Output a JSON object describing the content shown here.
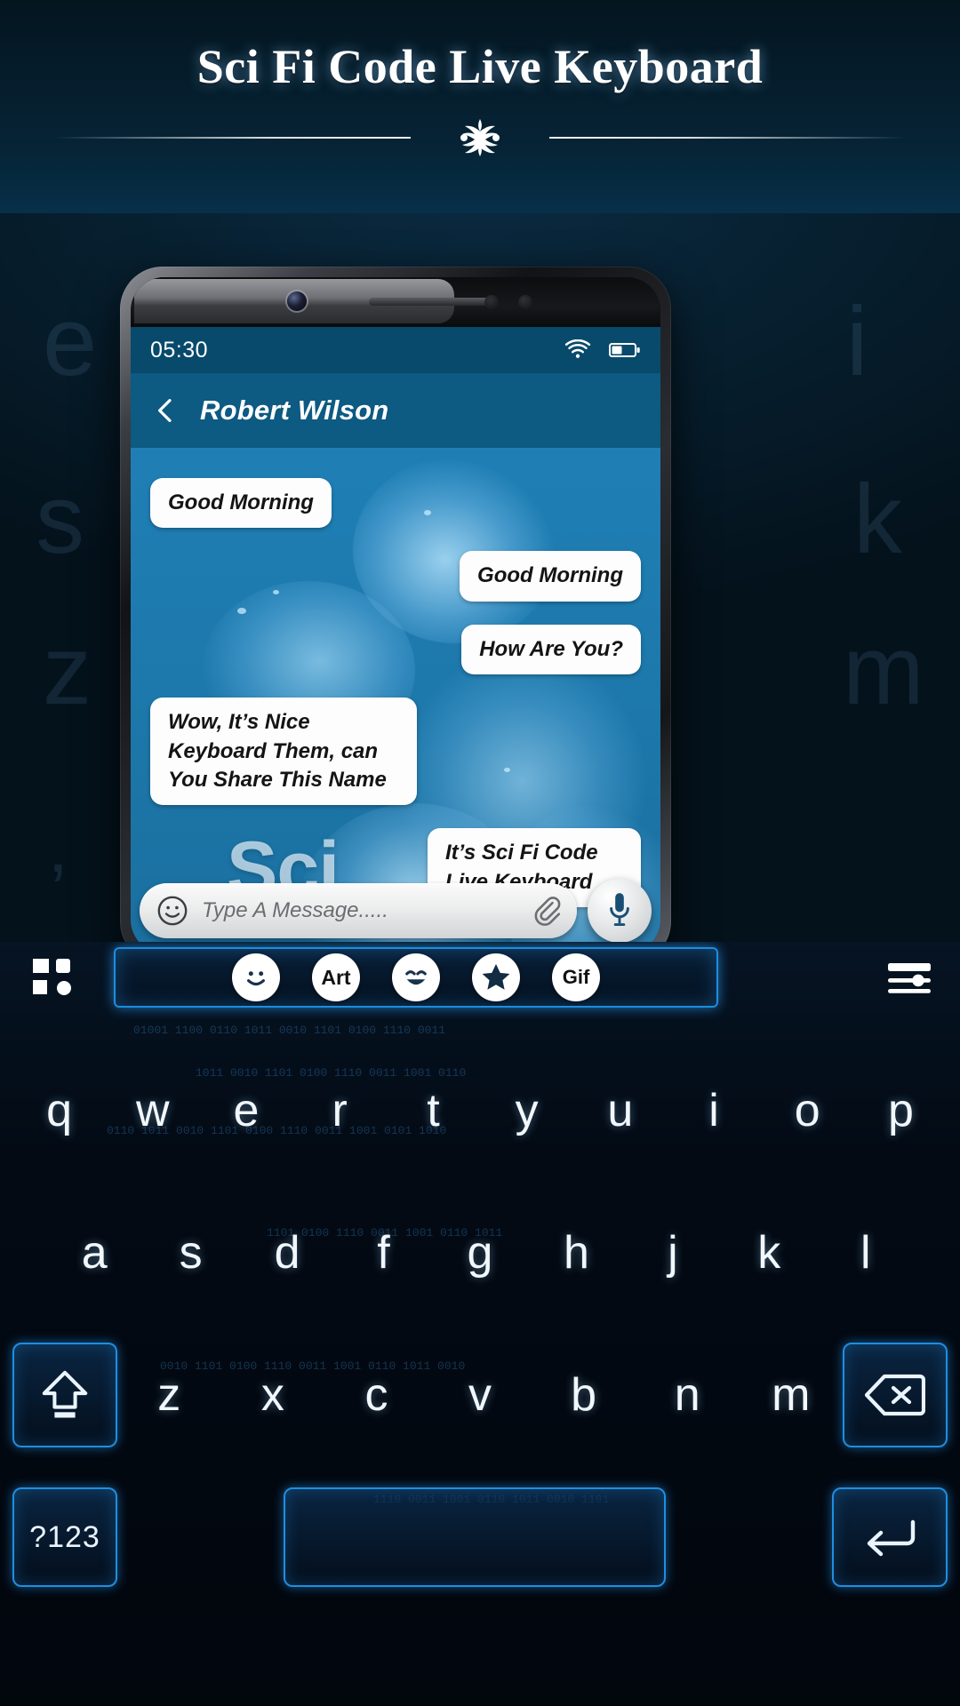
{
  "header": {
    "title": "Sci Fi Code Live Keyboard",
    "ornament_icon": "floral-divider-icon"
  },
  "preview_chips": [
    {
      "name": "smiley-chip",
      "label": "☺"
    },
    {
      "name": "art-chip",
      "label": "Art"
    },
    {
      "name": "grin-chip",
      "label": "ὠ1"
    },
    {
      "name": "star-chip",
      "label": "★"
    },
    {
      "name": "gif-chip",
      "label": "Gif"
    }
  ],
  "phone": {
    "statusbar": {
      "time": "05:30",
      "wifi_icon": "wifi-icon",
      "battery_icon": "battery-icon",
      "battery_level": 40
    },
    "chat_header": {
      "back_icon": "back-chevron-icon",
      "contact_name": "Robert Wilson"
    },
    "chat": {
      "watermark": "Sci",
      "messages": [
        {
          "side": "left",
          "text": "Good Morning"
        },
        {
          "side": "right",
          "text": "Good Morning"
        },
        {
          "side": "right",
          "text": "How Are You?"
        },
        {
          "side": "left",
          "text": "Wow, It’s Nice Keyboard Them, can You Share This Name"
        },
        {
          "side": "right",
          "text": "It’s Sci Fi Code Live Keyboard"
        }
      ]
    },
    "input": {
      "emoji_icon": "smiley-icon",
      "placeholder": "Type A Message.....",
      "attach_icon": "paperclip-icon",
      "mic_icon": "microphone-icon"
    }
  },
  "keyboard": {
    "toolbar": {
      "left_icon": "apps-grid-icon",
      "right_icon": "settings-slider-icon",
      "chips": [
        {
          "name": "emoji-smiley-chip",
          "label": "☺"
        },
        {
          "name": "art-chip",
          "label": "Art"
        },
        {
          "name": "emoji-grin-chip",
          "label": "ὠ1"
        },
        {
          "name": "sticker-star-chip",
          "label": "★"
        },
        {
          "name": "gif-chip",
          "label": "Gif"
        }
      ]
    },
    "rows": [
      [
        "q",
        "w",
        "e",
        "r",
        "t",
        "y",
        "u",
        "i",
        "o",
        "p"
      ],
      [
        "a",
        "s",
        "d",
        "f",
        "g",
        "h",
        "j",
        "k",
        "l"
      ],
      [
        "z",
        "x",
        "c",
        "v",
        "b",
        "n",
        "m"
      ]
    ],
    "shift_icon": "shift-up-arrow-icon",
    "backspace_icon": "backspace-delete-icon",
    "numeric_label": "?123",
    "space_label": "",
    "enter_icon": "enter-return-icon"
  },
  "colors": {
    "accent_glow": "#1d8de0",
    "chat_header_bg": "#0d5a82",
    "statusbar_bg": "#084a6b",
    "chat_bg": "#1f7fb5",
    "bubble_bg": "#fdfdfd"
  }
}
